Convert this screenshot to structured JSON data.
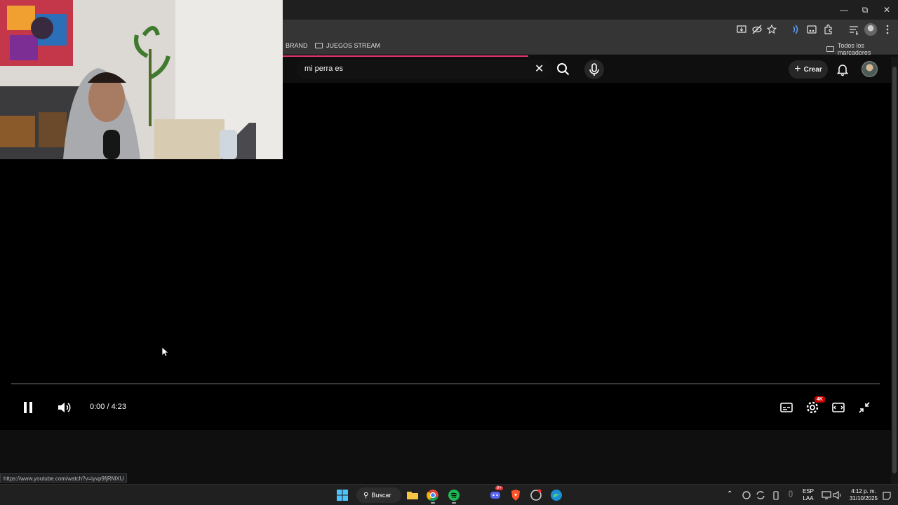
{
  "bookmarks": {
    "items": [
      {
        "label": "BRAND"
      },
      {
        "label": "JUEGOS STREAM"
      }
    ],
    "all_label": "Todos los marcadores"
  },
  "header": {
    "search_value": "mi perra es",
    "create_label": "Crear"
  },
  "player": {
    "time": "0:00 / 4:23",
    "quality_badge": "4K",
    "progress": 0
  },
  "status_bar": {
    "url": "https://www.youtube.com/watch?v=iyvp9fjRMXU"
  },
  "taskbar": {
    "search_label": "Buscar",
    "discord_badge": "9+",
    "language": "ESP",
    "layout": "LAA",
    "time": "4:12 p. m.",
    "date": "31/10/2025"
  },
  "colors": {
    "accent_loading": "#e6356f",
    "badge_red": "#cc0000",
    "background": "#0f0f0f"
  }
}
